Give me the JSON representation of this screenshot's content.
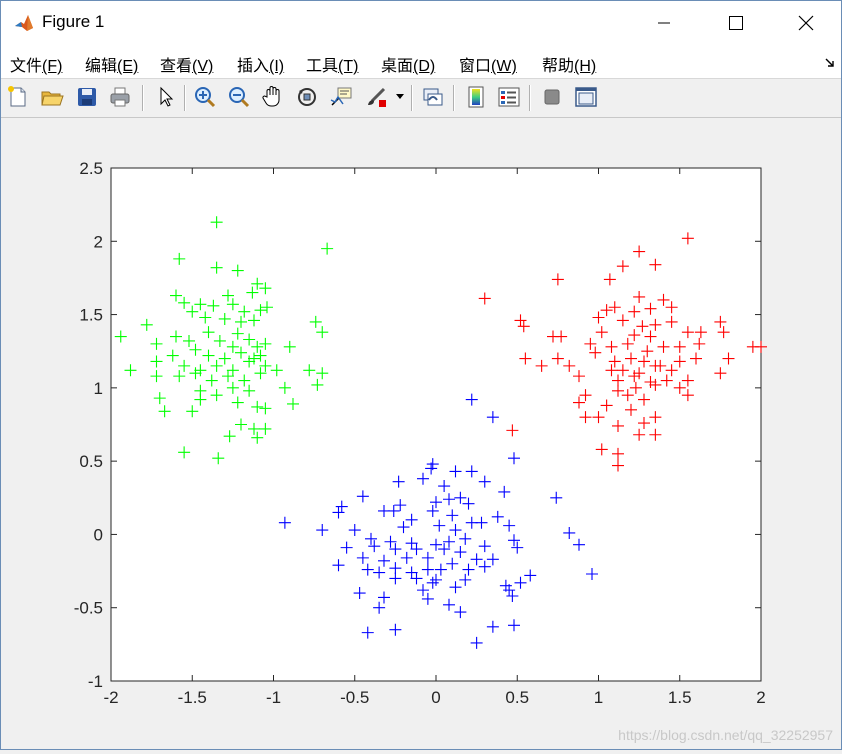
{
  "window": {
    "title": "Figure 1",
    "controls": {
      "minimize": "—",
      "maximize": "☐",
      "close": "✕"
    }
  },
  "menu": [
    {
      "label": "文件",
      "mnemonic": "(F)"
    },
    {
      "label": "编辑",
      "mnemonic": "(E)"
    },
    {
      "label": "查看",
      "mnemonic": "(V)"
    },
    {
      "label": "插入",
      "mnemonic": "(I)"
    },
    {
      "label": "工具",
      "mnemonic": "(T)"
    },
    {
      "label": "桌面",
      "mnemonic": "(D)"
    },
    {
      "label": "窗口",
      "mnemonic": "(W)"
    },
    {
      "label": "帮助",
      "mnemonic": "(H)"
    }
  ],
  "toolbar": {
    "icons": [
      "new-figure-icon",
      "open-file-icon",
      "save-icon",
      "print-icon",
      "select-arrow-icon",
      "zoom-in-icon",
      "zoom-out-icon",
      "pan-hand-icon",
      "rotate-3d-icon",
      "data-cursor-icon",
      "brush-icon",
      "link-plot-icon",
      "colorbar-icon",
      "legend-icon",
      "hide-plot-tools-icon",
      "show-plot-tools-icon"
    ]
  },
  "watermark": "https://blog.csdn.net/qq_32252957",
  "chart_data": {
    "type": "scatter",
    "xlim": [
      -2,
      2
    ],
    "ylim": [
      -1,
      2.5
    ],
    "xticks": [
      "-2",
      "-1.5",
      "-1",
      "-0.5",
      "0",
      "0.5",
      "1",
      "1.5",
      "2"
    ],
    "yticks": [
      "-1",
      "-0.5",
      "0",
      "0.5",
      "1",
      "1.5",
      "2",
      "2.5"
    ],
    "xtick_values": [
      -2,
      -1.5,
      -1,
      -0.5,
      0,
      0.5,
      1,
      1.5,
      2
    ],
    "ytick_values": [
      -1,
      -0.5,
      0,
      0.5,
      1,
      1.5,
      2,
      2.5
    ],
    "grid": false,
    "marker": "+",
    "series": [
      {
        "color": "#00ff00",
        "points": [
          [
            -1.35,
            2.13
          ],
          [
            -0.67,
            1.95
          ],
          [
            -1.58,
            1.88
          ],
          [
            -1.35,
            1.82
          ],
          [
            -1.22,
            1.8
          ],
          [
            -1.1,
            1.71
          ],
          [
            -1.05,
            1.68
          ],
          [
            -1.13,
            1.65
          ],
          [
            -1.28,
            1.63
          ],
          [
            -1.6,
            1.63
          ],
          [
            -1.55,
            1.58
          ],
          [
            -1.45,
            1.57
          ],
          [
            -1.37,
            1.56
          ],
          [
            -1.25,
            1.57
          ],
          [
            -1.18,
            1.52
          ],
          [
            -1.08,
            1.53
          ],
          [
            -1.04,
            1.55
          ],
          [
            -1.5,
            1.52
          ],
          [
            -1.42,
            1.48
          ],
          [
            -1.3,
            1.47
          ],
          [
            -1.2,
            1.45
          ],
          [
            -1.12,
            1.46
          ],
          [
            -1.78,
            1.43
          ],
          [
            -0.74,
            1.45
          ],
          [
            -1.94,
            1.35
          ],
          [
            -1.6,
            1.35
          ],
          [
            -1.52,
            1.32
          ],
          [
            -1.4,
            1.38
          ],
          [
            -1.33,
            1.32
          ],
          [
            -1.22,
            1.37
          ],
          [
            -1.15,
            1.33
          ],
          [
            -1.05,
            1.3
          ],
          [
            -0.7,
            1.38
          ],
          [
            -1.72,
            1.3
          ],
          [
            -1.48,
            1.26
          ],
          [
            -1.4,
            1.22
          ],
          [
            -1.3,
            1.2
          ],
          [
            -1.2,
            1.24
          ],
          [
            -1.1,
            1.28
          ],
          [
            -1.08,
            1.22
          ],
          [
            -0.9,
            1.28
          ],
          [
            -1.72,
            1.18
          ],
          [
            -1.62,
            1.22
          ],
          [
            -1.55,
            1.15
          ],
          [
            -1.45,
            1.12
          ],
          [
            -1.35,
            1.15
          ],
          [
            -1.25,
            1.12
          ],
          [
            -1.15,
            1.18
          ],
          [
            -1.05,
            1.15
          ],
          [
            -0.78,
            1.12
          ],
          [
            -1.88,
            1.12
          ],
          [
            -1.72,
            1.08
          ],
          [
            -1.58,
            1.08
          ],
          [
            -1.48,
            1.1
          ],
          [
            -1.38,
            1.05
          ],
          [
            -1.28,
            1.08
          ],
          [
            -1.18,
            1.05
          ],
          [
            -1.08,
            1.1
          ],
          [
            -0.98,
            1.12
          ],
          [
            -0.7,
            1.1
          ],
          [
            -1.45,
            0.98
          ],
          [
            -1.35,
            0.95
          ],
          [
            -1.25,
            1.0
          ],
          [
            -1.15,
            0.98
          ],
          [
            -0.93,
            1.0
          ],
          [
            -0.73,
            1.02
          ],
          [
            -1.7,
            0.93
          ],
          [
            -1.45,
            0.92
          ],
          [
            -1.22,
            0.9
          ],
          [
            -1.1,
            0.87
          ],
          [
            -1.05,
            0.86
          ],
          [
            -0.88,
            0.89
          ],
          [
            -1.67,
            0.84
          ],
          [
            -1.5,
            0.84
          ],
          [
            -1.2,
            0.75
          ],
          [
            -1.12,
            0.72
          ],
          [
            -1.05,
            0.72
          ],
          [
            -1.27,
            0.67
          ],
          [
            -1.1,
            0.66
          ],
          [
            -1.55,
            0.56
          ],
          [
            -1.34,
            0.52
          ],
          [
            -1.12,
            1.2
          ],
          [
            -1.25,
            1.28
          ]
        ]
      },
      {
        "color": "#ff0000",
        "points": [
          [
            1.25,
            1.93
          ],
          [
            1.55,
            2.02
          ],
          [
            1.15,
            1.83
          ],
          [
            1.35,
            1.84
          ],
          [
            0.75,
            1.74
          ],
          [
            1.07,
            1.74
          ],
          [
            0.3,
            1.61
          ],
          [
            1.25,
            1.62
          ],
          [
            1.4,
            1.6
          ],
          [
            1.45,
            1.55
          ],
          [
            1.05,
            1.53
          ],
          [
            1.1,
            1.55
          ],
          [
            1.22,
            1.52
          ],
          [
            1.32,
            1.54
          ],
          [
            0.52,
            1.46
          ],
          [
            0.54,
            1.42
          ],
          [
            1.0,
            1.48
          ],
          [
            1.15,
            1.46
          ],
          [
            1.27,
            1.42
          ],
          [
            1.35,
            1.43
          ],
          [
            1.45,
            1.45
          ],
          [
            1.75,
            1.45
          ],
          [
            0.72,
            1.35
          ],
          [
            0.77,
            1.35
          ],
          [
            1.02,
            1.38
          ],
          [
            1.22,
            1.36
          ],
          [
            1.32,
            1.35
          ],
          [
            1.55,
            1.38
          ],
          [
            1.63,
            1.38
          ],
          [
            1.77,
            1.38
          ],
          [
            0.95,
            1.3
          ],
          [
            1.08,
            1.28
          ],
          [
            1.18,
            1.3
          ],
          [
            1.3,
            1.25
          ],
          [
            1.4,
            1.28
          ],
          [
            1.62,
            1.3
          ],
          [
            1.95,
            1.28
          ],
          [
            2.0,
            1.28
          ],
          [
            0.55,
            1.2
          ],
          [
            0.75,
            1.2
          ],
          [
            0.98,
            1.24
          ],
          [
            1.1,
            1.18
          ],
          [
            1.2,
            1.2
          ],
          [
            1.28,
            1.18
          ],
          [
            1.38,
            1.15
          ],
          [
            1.5,
            1.18
          ],
          [
            1.8,
            1.2
          ],
          [
            0.65,
            1.15
          ],
          [
            0.82,
            1.15
          ],
          [
            1.15,
            1.12
          ],
          [
            1.25,
            1.1
          ],
          [
            1.35,
            1.15
          ],
          [
            1.45,
            1.12
          ],
          [
            0.88,
            1.08
          ],
          [
            1.12,
            1.05
          ],
          [
            1.22,
            1.08
          ],
          [
            1.32,
            1.04
          ],
          [
            1.42,
            1.05
          ],
          [
            1.75,
            1.1
          ],
          [
            1.55,
            1.05
          ],
          [
            1.12,
            0.98
          ],
          [
            1.23,
            1.0
          ],
          [
            1.35,
            1.02
          ],
          [
            1.5,
            1.0
          ],
          [
            0.92,
            0.95
          ],
          [
            1.18,
            0.95
          ],
          [
            1.28,
            0.92
          ],
          [
            1.55,
            0.95
          ],
          [
            0.88,
            0.9
          ],
          [
            1.05,
            0.88
          ],
          [
            1.2,
            0.85
          ],
          [
            0.92,
            0.8
          ],
          [
            1.0,
            0.8
          ],
          [
            1.35,
            0.8
          ],
          [
            1.28,
            0.76
          ],
          [
            1.12,
            0.74
          ],
          [
            0.47,
            0.71
          ],
          [
            1.25,
            0.68
          ],
          [
            1.35,
            0.68
          ],
          [
            1.02,
            0.58
          ],
          [
            1.12,
            0.55
          ],
          [
            1.12,
            0.47
          ],
          [
            1.5,
            1.28
          ],
          [
            1.6,
            1.2
          ],
          [
            1.08,
            1.12
          ]
        ]
      },
      {
        "color": "#0000ff",
        "points": [
          [
            0.22,
            0.92
          ],
          [
            0.35,
            0.8
          ],
          [
            0.48,
            0.52
          ],
          [
            -0.02,
            0.48
          ],
          [
            -0.03,
            0.45
          ],
          [
            0.12,
            0.43
          ],
          [
            0.22,
            0.43
          ],
          [
            -0.23,
            0.36
          ],
          [
            -0.08,
            0.38
          ],
          [
            0.05,
            0.33
          ],
          [
            0.3,
            0.36
          ],
          [
            0.42,
            0.29
          ],
          [
            0.74,
            0.25
          ],
          [
            -0.45,
            0.26
          ],
          [
            -0.22,
            0.2
          ],
          [
            0.0,
            0.22
          ],
          [
            0.08,
            0.24
          ],
          [
            0.15,
            0.25
          ],
          [
            0.2,
            0.21
          ],
          [
            -0.58,
            0.19
          ],
          [
            -0.6,
            0.15
          ],
          [
            -0.32,
            0.16
          ],
          [
            -0.26,
            0.16
          ],
          [
            -0.15,
            0.1
          ],
          [
            -0.02,
            0.16
          ],
          [
            0.1,
            0.13
          ],
          [
            0.22,
            0.08
          ],
          [
            0.38,
            0.12
          ],
          [
            -0.93,
            0.08
          ],
          [
            -0.7,
            0.03
          ],
          [
            -0.5,
            0.03
          ],
          [
            -0.2,
            0.05
          ],
          [
            0.02,
            0.06
          ],
          [
            0.12,
            0.03
          ],
          [
            0.28,
            0.08
          ],
          [
            0.45,
            0.06
          ],
          [
            0.82,
            0.01
          ],
          [
            -0.4,
            -0.03
          ],
          [
            -0.28,
            -0.05
          ],
          [
            -0.15,
            -0.06
          ],
          [
            0.0,
            -0.07
          ],
          [
            0.08,
            -0.05
          ],
          [
            0.18,
            -0.03
          ],
          [
            0.48,
            -0.04
          ],
          [
            0.88,
            -0.07
          ],
          [
            -0.55,
            -0.09
          ],
          [
            -0.38,
            -0.08
          ],
          [
            -0.25,
            -0.1
          ],
          [
            -0.12,
            -0.1
          ],
          [
            0.05,
            -0.1
          ],
          [
            0.15,
            -0.12
          ],
          [
            0.3,
            -0.08
          ],
          [
            0.5,
            -0.09
          ],
          [
            -0.45,
            -0.16
          ],
          [
            -0.32,
            -0.18
          ],
          [
            -0.18,
            -0.16
          ],
          [
            -0.05,
            -0.16
          ],
          [
            0.1,
            -0.2
          ],
          [
            0.25,
            -0.17
          ],
          [
            0.35,
            -0.17
          ],
          [
            -0.6,
            -0.21
          ],
          [
            -0.42,
            -0.24
          ],
          [
            -0.35,
            -0.26
          ],
          [
            -0.25,
            -0.23
          ],
          [
            -0.15,
            -0.26
          ],
          [
            -0.05,
            -0.24
          ],
          [
            0.03,
            -0.24
          ],
          [
            0.2,
            -0.24
          ],
          [
            0.3,
            -0.22
          ],
          [
            0.96,
            -0.27
          ],
          [
            -0.25,
            -0.3
          ],
          [
            -0.12,
            -0.3
          ],
          [
            0.0,
            -0.31
          ],
          [
            0.18,
            -0.31
          ],
          [
            0.58,
            -0.28
          ],
          [
            0.43,
            -0.35
          ],
          [
            -0.47,
            -0.4
          ],
          [
            -0.08,
            -0.38
          ],
          [
            0.45,
            -0.38
          ],
          [
            0.52,
            -0.33
          ],
          [
            -0.32,
            -0.43
          ],
          [
            0.47,
            -0.42
          ],
          [
            -0.05,
            -0.44
          ],
          [
            0.08,
            -0.48
          ],
          [
            -0.35,
            -0.5
          ],
          [
            0.15,
            -0.53
          ],
          [
            0.35,
            -0.63
          ],
          [
            0.48,
            -0.62
          ],
          [
            -0.25,
            -0.65
          ],
          [
            -0.42,
            -0.67
          ],
          [
            0.25,
            -0.74
          ],
          [
            -0.02,
            -0.33
          ],
          [
            0.12,
            -0.36
          ]
        ]
      }
    ]
  }
}
